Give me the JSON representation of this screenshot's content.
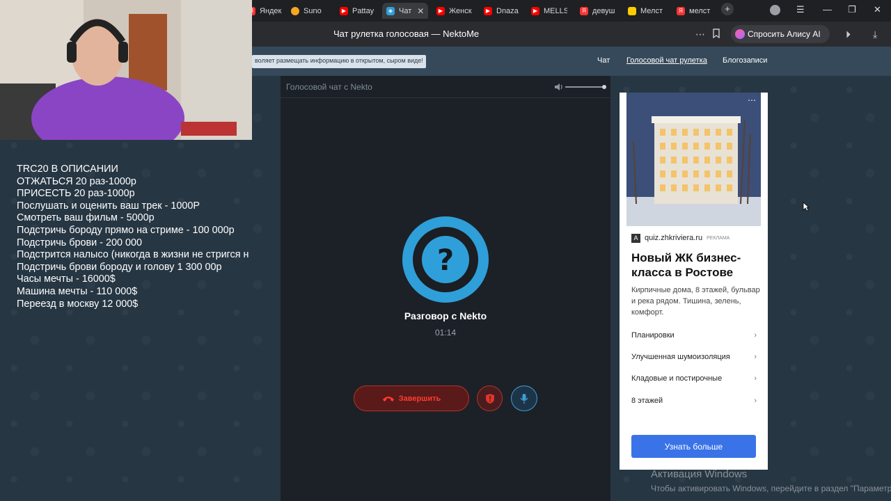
{
  "browser": {
    "tabs": [
      {
        "label": "Яндекс",
        "icon": "yandex-icon",
        "color": "#ff3333"
      },
      {
        "label": "Suno",
        "icon": "suno-icon",
        "color": "#f5a623"
      },
      {
        "label": "Pattay",
        "icon": "youtube-icon",
        "color": "#ff0000"
      },
      {
        "label": "Чат",
        "icon": "nekto-icon",
        "color": "#2f9fd9",
        "active": true
      },
      {
        "label": "Женск",
        "icon": "youtube-icon",
        "color": "#ff0000"
      },
      {
        "label": "Dnaza",
        "icon": "youtube-icon",
        "color": "#ff0000"
      },
      {
        "label": "MELLS",
        "icon": "youtube-icon",
        "color": "#ff0000"
      },
      {
        "label": "девуш",
        "icon": "yandex-icon",
        "color": "#ff3333"
      },
      {
        "label": "Мелст",
        "icon": "image-icon",
        "color": "#ffcc00"
      },
      {
        "label": "мелст",
        "icon": "yandex-icon",
        "color": "#ff3333"
      }
    ],
    "page_title": "Чат рулетка голосовая — NektoMe",
    "alice_button": "Спросить Алису AI"
  },
  "site": {
    "notice": "воляет размещать информацию в открытом, сыром виде!",
    "nav": [
      "Чат",
      "Голосовой чат рулетка",
      "Блогозаписи"
    ]
  },
  "stream_overlay": {
    "lines": [
      "TRC20 В ОПИСАНИИ",
      "ОТЖАТЬСЯ 20 раз-1000р",
      "ПРИСЕСТЬ 20 раз-1000р",
      "Послушать и оценить ваш трек - 1000Р",
      "Смотреть ваш фильм - 5000р",
      "Подстричь бороду прямо на стриме - 100 000р",
      "Подстричь брови - 200 000",
      "Подстрится налысо (никогда в жизни не стригся н",
      "Подстричь брови бороду и голову 1 300 00р",
      "Часы мечты - 16000$",
      "Машина мечты - 110 000$",
      "Переезд в москву 12 000$"
    ]
  },
  "chat": {
    "header": "Голосовой чат с Nekto",
    "volume_level": 1.0,
    "avatar_glyph": "?",
    "conversation_title": "Разговор с Nekto",
    "timer": "01:14",
    "end_button": "Завершить",
    "accent_color": "#2f9fd9",
    "danger_color": "#ff3b30"
  },
  "ad": {
    "logo_letter": "A",
    "domain": "quiz.zhkriviera.ru",
    "ad_label": "РЕКЛАМА",
    "headline": "Новый ЖК бизнес-класса в Ростове",
    "body": "Кирпичные дома, 8 этажей, бульвар и река рядом. Тишина, зелень, комфорт.",
    "links": [
      "Планировки",
      "Улучшенная шумоизоляция",
      "Кладовые и постирочные",
      "8 этажей"
    ],
    "cta": "Узнать больше"
  },
  "windows_watermark": {
    "title": "Активация Windows",
    "text": "Чтобы активировать Windows, перейдите в раздел \"Параметры\"."
  }
}
